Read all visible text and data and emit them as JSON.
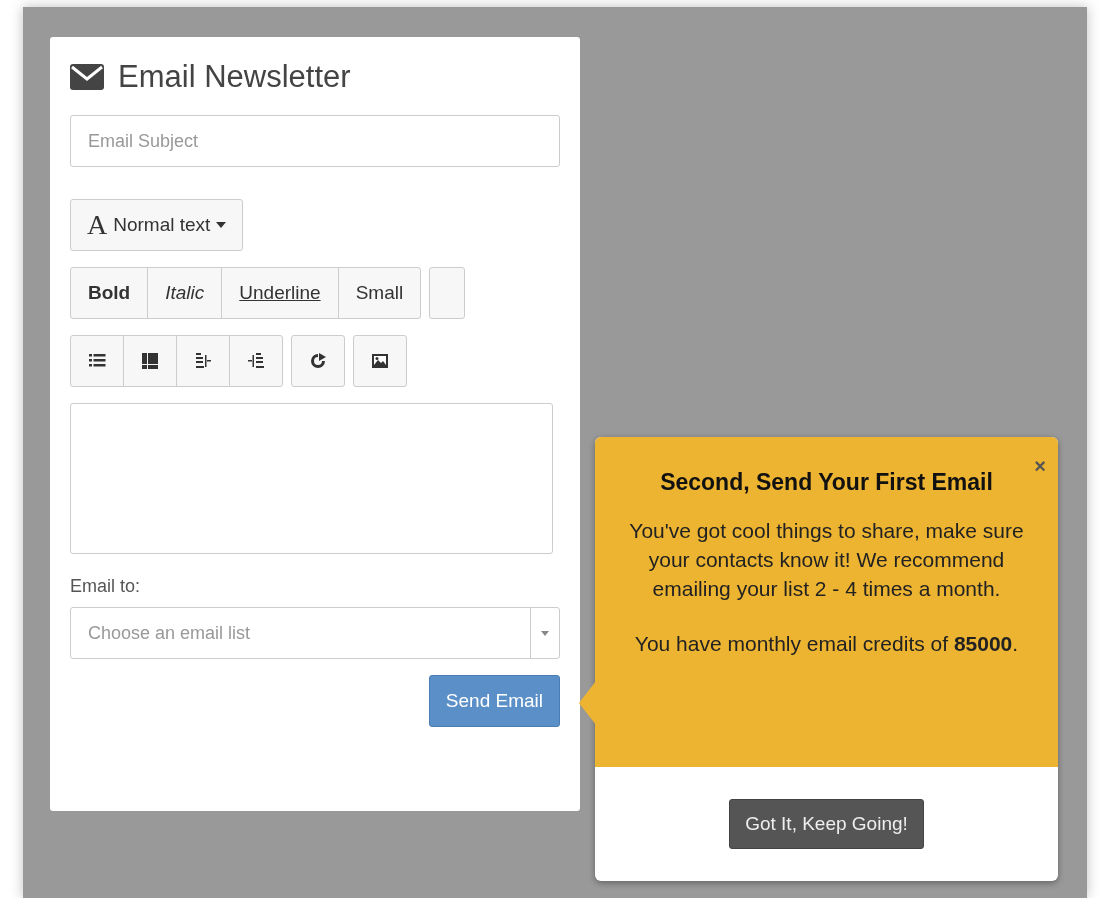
{
  "card": {
    "title": "Email Newsletter",
    "subject": {
      "placeholder": "Email Subject"
    },
    "style_dropdown": {
      "glyph": "A",
      "label": "Normal text"
    },
    "format_buttons": [
      {
        "kind": "bold",
        "label": "Bold"
      },
      {
        "kind": "italic",
        "label": "Italic"
      },
      {
        "kind": "underline",
        "label": "Underline"
      },
      {
        "kind": "small",
        "label": "Small"
      }
    ],
    "email_to": {
      "label": "Email to:",
      "placeholder": "Choose an email list"
    },
    "send_button": "Send Email"
  },
  "popover": {
    "close": "×",
    "title": "Second, Send Your First Email",
    "paragraphs": [
      "You've got cool things to share, make sure your contacts know it! We recommend emailing your list 2 - 4 times a month.",
      "You have monthly email credits of **85000**."
    ],
    "button": "Got It, Keep Going!"
  }
}
